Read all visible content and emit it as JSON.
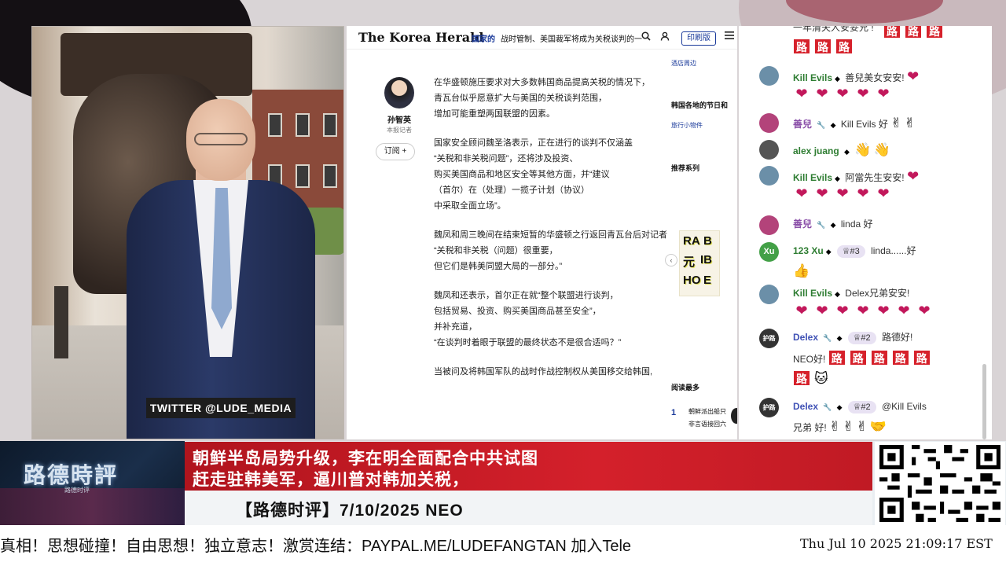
{
  "video": {
    "twitter_handle": "TWITTER  @LUDE_MEDIA"
  },
  "article": {
    "site_logo": "The Korea Herald",
    "section": "国家的",
    "header_headline": "战时管制、美国裁军将成为关税谈判的一",
    "print_label": "印刷版",
    "author_name": "孙智英",
    "author_role": "本报记者",
    "subscribe_label": "订阅 +",
    "paragraphs": [
      [
        "在华盛顿施压要求对大多数韩国商品提高关税的情况下，",
        "青瓦台似乎愿意扩大与美国的关税谈判范围，",
        "增加可能重塑两国联盟的因素。"
      ],
      [
        "国家安全顾问魏圣洛表示，正在进行的谈判不仅涵盖",
        "“关税和非关税问题”，还将涉及投资、",
        "购买美国商品和地区安全等其他方面，并“建议",
        "（首尔）在（处理）一揽子计划（协议）",
        "中采取全面立场”。"
      ],
      [
        "魏凤和周三晚间在结束短暂的华盛顿之行返回青瓦台后对记者",
        "“关税和非关税（问题）很重要，",
        "但它们是韩美同盟大局的一部分。”"
      ],
      [
        "魏凤和还表示，首尔正在就“整个联盟进行谈判，",
        "包括贸易、投资、购买美国商品甚至安全”，",
        "并补充道，",
        "“在谈判时着眼于联盟的最终状态不是很合适吗？”"
      ],
      [
        "当被问及将韩国军队的战时作战控制权从美国移交给韩国,"
      ]
    ],
    "sidebar": {
      "hotel_link": "酒店周边",
      "festival_head": "韩国各地的节日和",
      "travel_link": "旅行小物件",
      "recommend_head": "推荐系列",
      "popular_head": "阅读最多",
      "popular_num": "1",
      "popular_text1": "朝鲜派出船只",
      "popular_text2": "非言语接回六"
    }
  },
  "chat": {
    "partial_top": "一年清夫人安妥兄 !",
    "messages": [
      {
        "user": "Kill Evils",
        "text": "善兒美女安安!"
      },
      {
        "user": "善兒",
        "text": "Kill Evils 好"
      },
      {
        "user": "alex juang",
        "text": ""
      },
      {
        "user": "Kill Evils",
        "text": "阿當先生安安!"
      },
      {
        "user": "善兒",
        "text": "linda 好"
      },
      {
        "user": "123 Xu",
        "tier": "#3",
        "text": "linda......好"
      },
      {
        "user": "Kill Evils",
        "text": "Delex兄弟安安!"
      },
      {
        "user": "Delex",
        "tier": "#2",
        "text": "路德好!",
        "text2": "NEO好!"
      },
      {
        "user": "Delex",
        "tier": "#2",
        "text": "@Kill Evils",
        "text2": "兄弟 好!"
      }
    ],
    "lu_char": "路",
    "avatar_initials": {
      "xu": "Xu",
      "delex": "护路"
    }
  },
  "lower_third": {
    "logo_title": "路德時評",
    "logo_sub": "路德时评",
    "headline_line1": "朝鲜半岛局势升级，李在明全面配合中共试图",
    "headline_line2": "赶走驻韩美军，逼川普对韩加关税，",
    "program_line": "【路德时评】7/10/2025 NEO"
  },
  "ticker": {
    "text": "真相！思想碰撞！自由思想！独立意志！激赏连结：PAYPAL.ME/LUDEFANGTAN  加入Tele",
    "timestamp": "Thu Jul 10 2025 21:09:17 EST"
  },
  "colors": {
    "accent_red": "#d4202b",
    "kh_blue": "#1a3a9a",
    "chat_green": "#2e7d32"
  }
}
